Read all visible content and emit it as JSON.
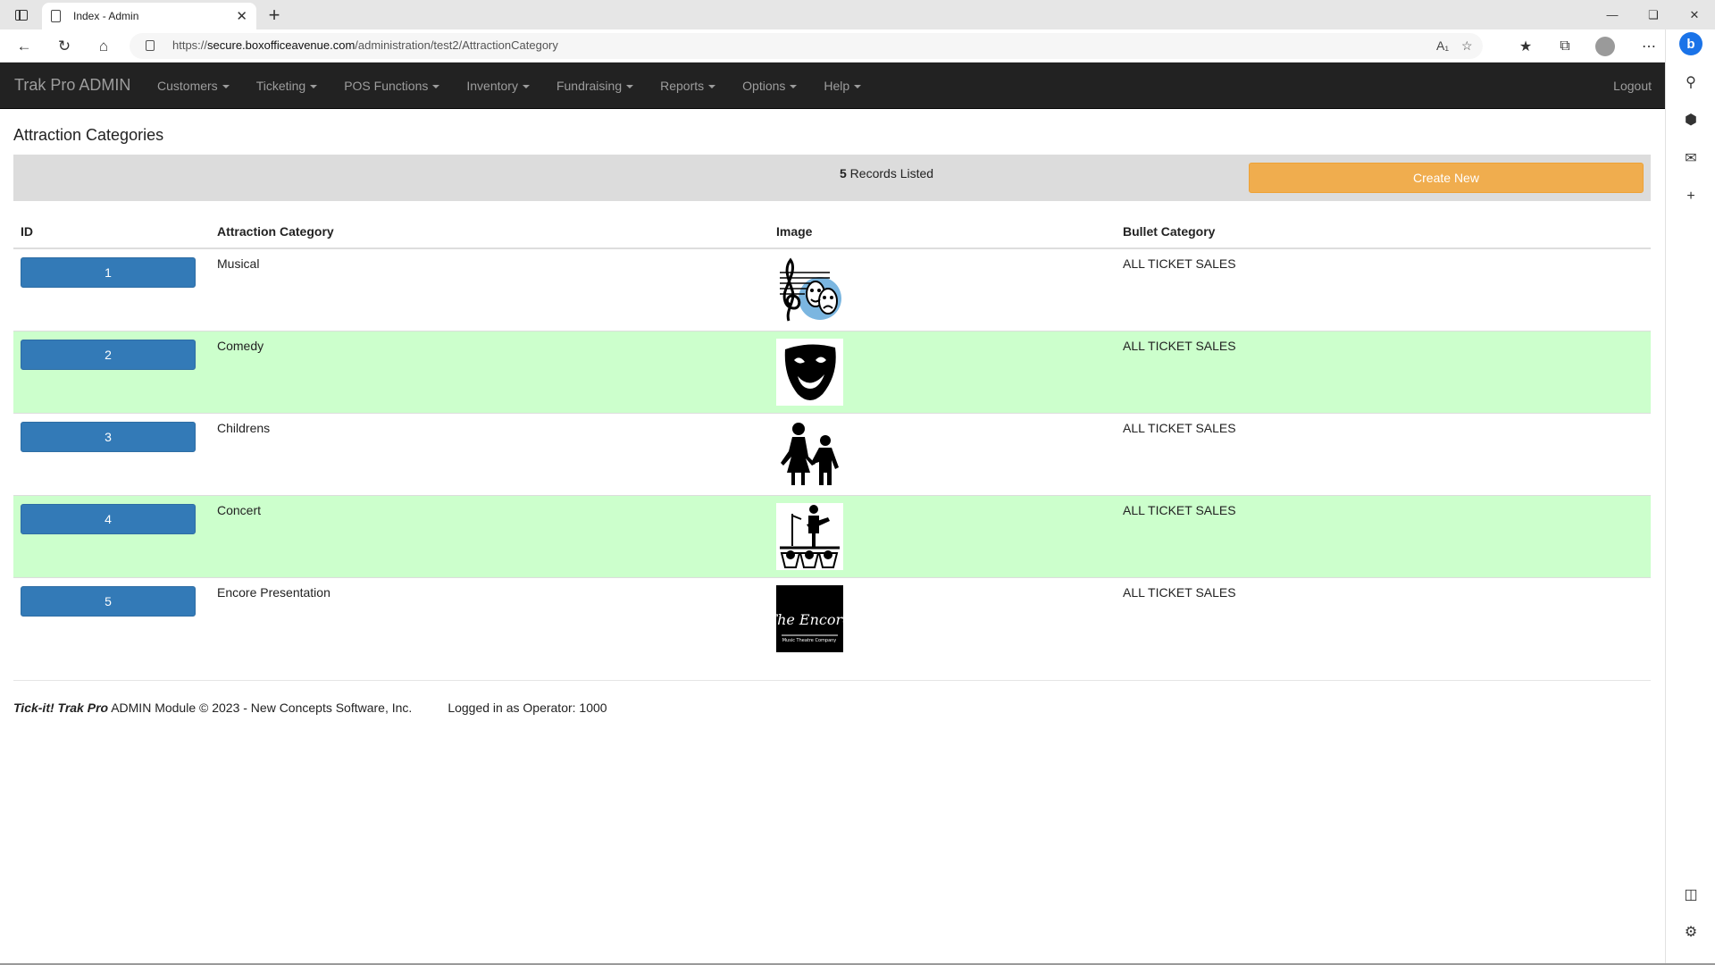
{
  "browser": {
    "tab_title": "Index - Admin",
    "tab_close": "✕",
    "new_tab": "+",
    "url_prefix": "https://",
    "url_host": "secure.boxofficeavenue.com",
    "url_path": "/administration/test2/AttractionCategory"
  },
  "navbar": {
    "brand": "Trak Pro ADMIN",
    "menu": [
      "Customers",
      "Ticketing",
      "POS Functions",
      "Inventory",
      "Fundraising",
      "Reports",
      "Options",
      "Help"
    ],
    "logout": "Logout"
  },
  "page": {
    "title": "Attraction Categories",
    "records_count": "5",
    "records_label": " Records Listed",
    "create_new": "Create New"
  },
  "table": {
    "headers": [
      "ID",
      "Attraction Category",
      "Image",
      "Bullet Category"
    ],
    "rows": [
      {
        "id": "1",
        "category": "Musical",
        "image": "musical-masks-icon",
        "bullet": "ALL TICKET SALES"
      },
      {
        "id": "2",
        "category": "Comedy",
        "image": "comedy-mask-icon",
        "bullet": "ALL TICKET SALES"
      },
      {
        "id": "3",
        "category": "Childrens",
        "image": "children-icon",
        "bullet": "ALL TICKET SALES"
      },
      {
        "id": "4",
        "category": "Concert",
        "image": "concert-stage-icon",
        "bullet": "ALL TICKET SALES"
      },
      {
        "id": "5",
        "category": "Encore Presentation",
        "image": "encore-logo",
        "bullet": "ALL TICKET SALES"
      }
    ],
    "encore_logo_text": "The Encore",
    "encore_logo_sub": "Music Theatre Company"
  },
  "footer": {
    "brand": "Tick-it! Trak Pro",
    "text": " ADMIN Module © 2023 - New Concepts Software, Inc.",
    "operator": "Logged in as Operator: 1000"
  },
  "colors": {
    "navbar_bg": "#222222",
    "create_btn": "#f0ad4e",
    "id_btn": "#337ab7",
    "alt_row": "#ccffcc"
  }
}
